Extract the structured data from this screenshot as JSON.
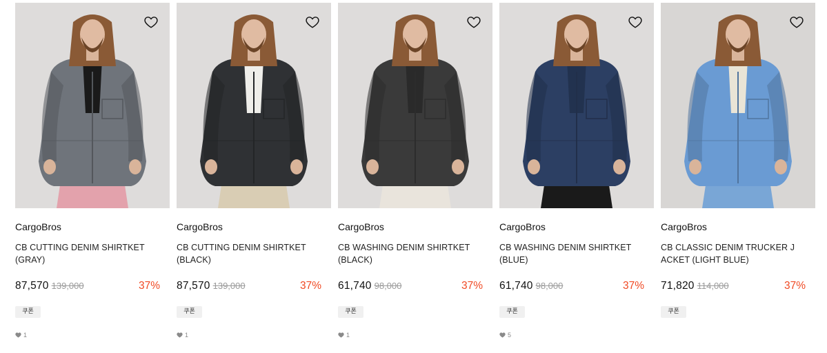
{
  "products": [
    {
      "brand": "CargoBros",
      "name": "CB CUTTING DENIM SHIRTKET (GRAY)",
      "price": "87,570",
      "original_price": "139,000",
      "discount": "37%",
      "coupon_label": "쿠폰",
      "likes": "1",
      "colors": {
        "bg": "#dedcdb",
        "jacket": "#6f747b",
        "inner": "#1a1a1a",
        "pants": "#e3a2ac"
      }
    },
    {
      "brand": "CargoBros",
      "name": "CB CUTTING DENIM SHIRTKET (BLACK)",
      "price": "87,570",
      "original_price": "139,000",
      "discount": "37%",
      "coupon_label": "쿠폰",
      "likes": "1",
      "colors": {
        "bg": "#dedcdb",
        "jacket": "#2f3134",
        "inner": "#efeeea",
        "pants": "#d9cdb4"
      }
    },
    {
      "brand": "CargoBros",
      "name": "CB WASHING DENIM SHIRTKET (BLACK)",
      "price": "61,740",
      "original_price": "98,000",
      "discount": "37%",
      "coupon_label": "쿠폰",
      "likes": "1",
      "colors": {
        "bg": "#dedcdb",
        "jacket": "#3a3a3a",
        "inner": "#2a2a2a",
        "pants": "#e9e4dc"
      }
    },
    {
      "brand": "CargoBros",
      "name": "CB WASHING DENIM SHIRTKET (BLUE)",
      "price": "61,740",
      "original_price": "98,000",
      "discount": "37%",
      "coupon_label": "쿠폰",
      "likes": "5",
      "colors": {
        "bg": "#dedcdb",
        "jacket": "#2c3f63",
        "inner": "#22324f",
        "pants": "#1a1a1a"
      }
    },
    {
      "brand": "CargoBros",
      "name": "CB CLASSIC DENIM TRUCKER JACKET (LIGHT BLUE)",
      "price": "71,820",
      "original_price": "114,000",
      "discount": "37%",
      "coupon_label": "쿠폰",
      "likes": "",
      "colors": {
        "bg": "#d8d6d4",
        "jacket": "#6a9bd3",
        "inner": "#e9e4d6",
        "pants": "#79a6d6"
      }
    }
  ],
  "accent_color": "#f04a24",
  "icons": {
    "wishlist": "heart-outline-icon",
    "like": "heart-filled-icon"
  }
}
